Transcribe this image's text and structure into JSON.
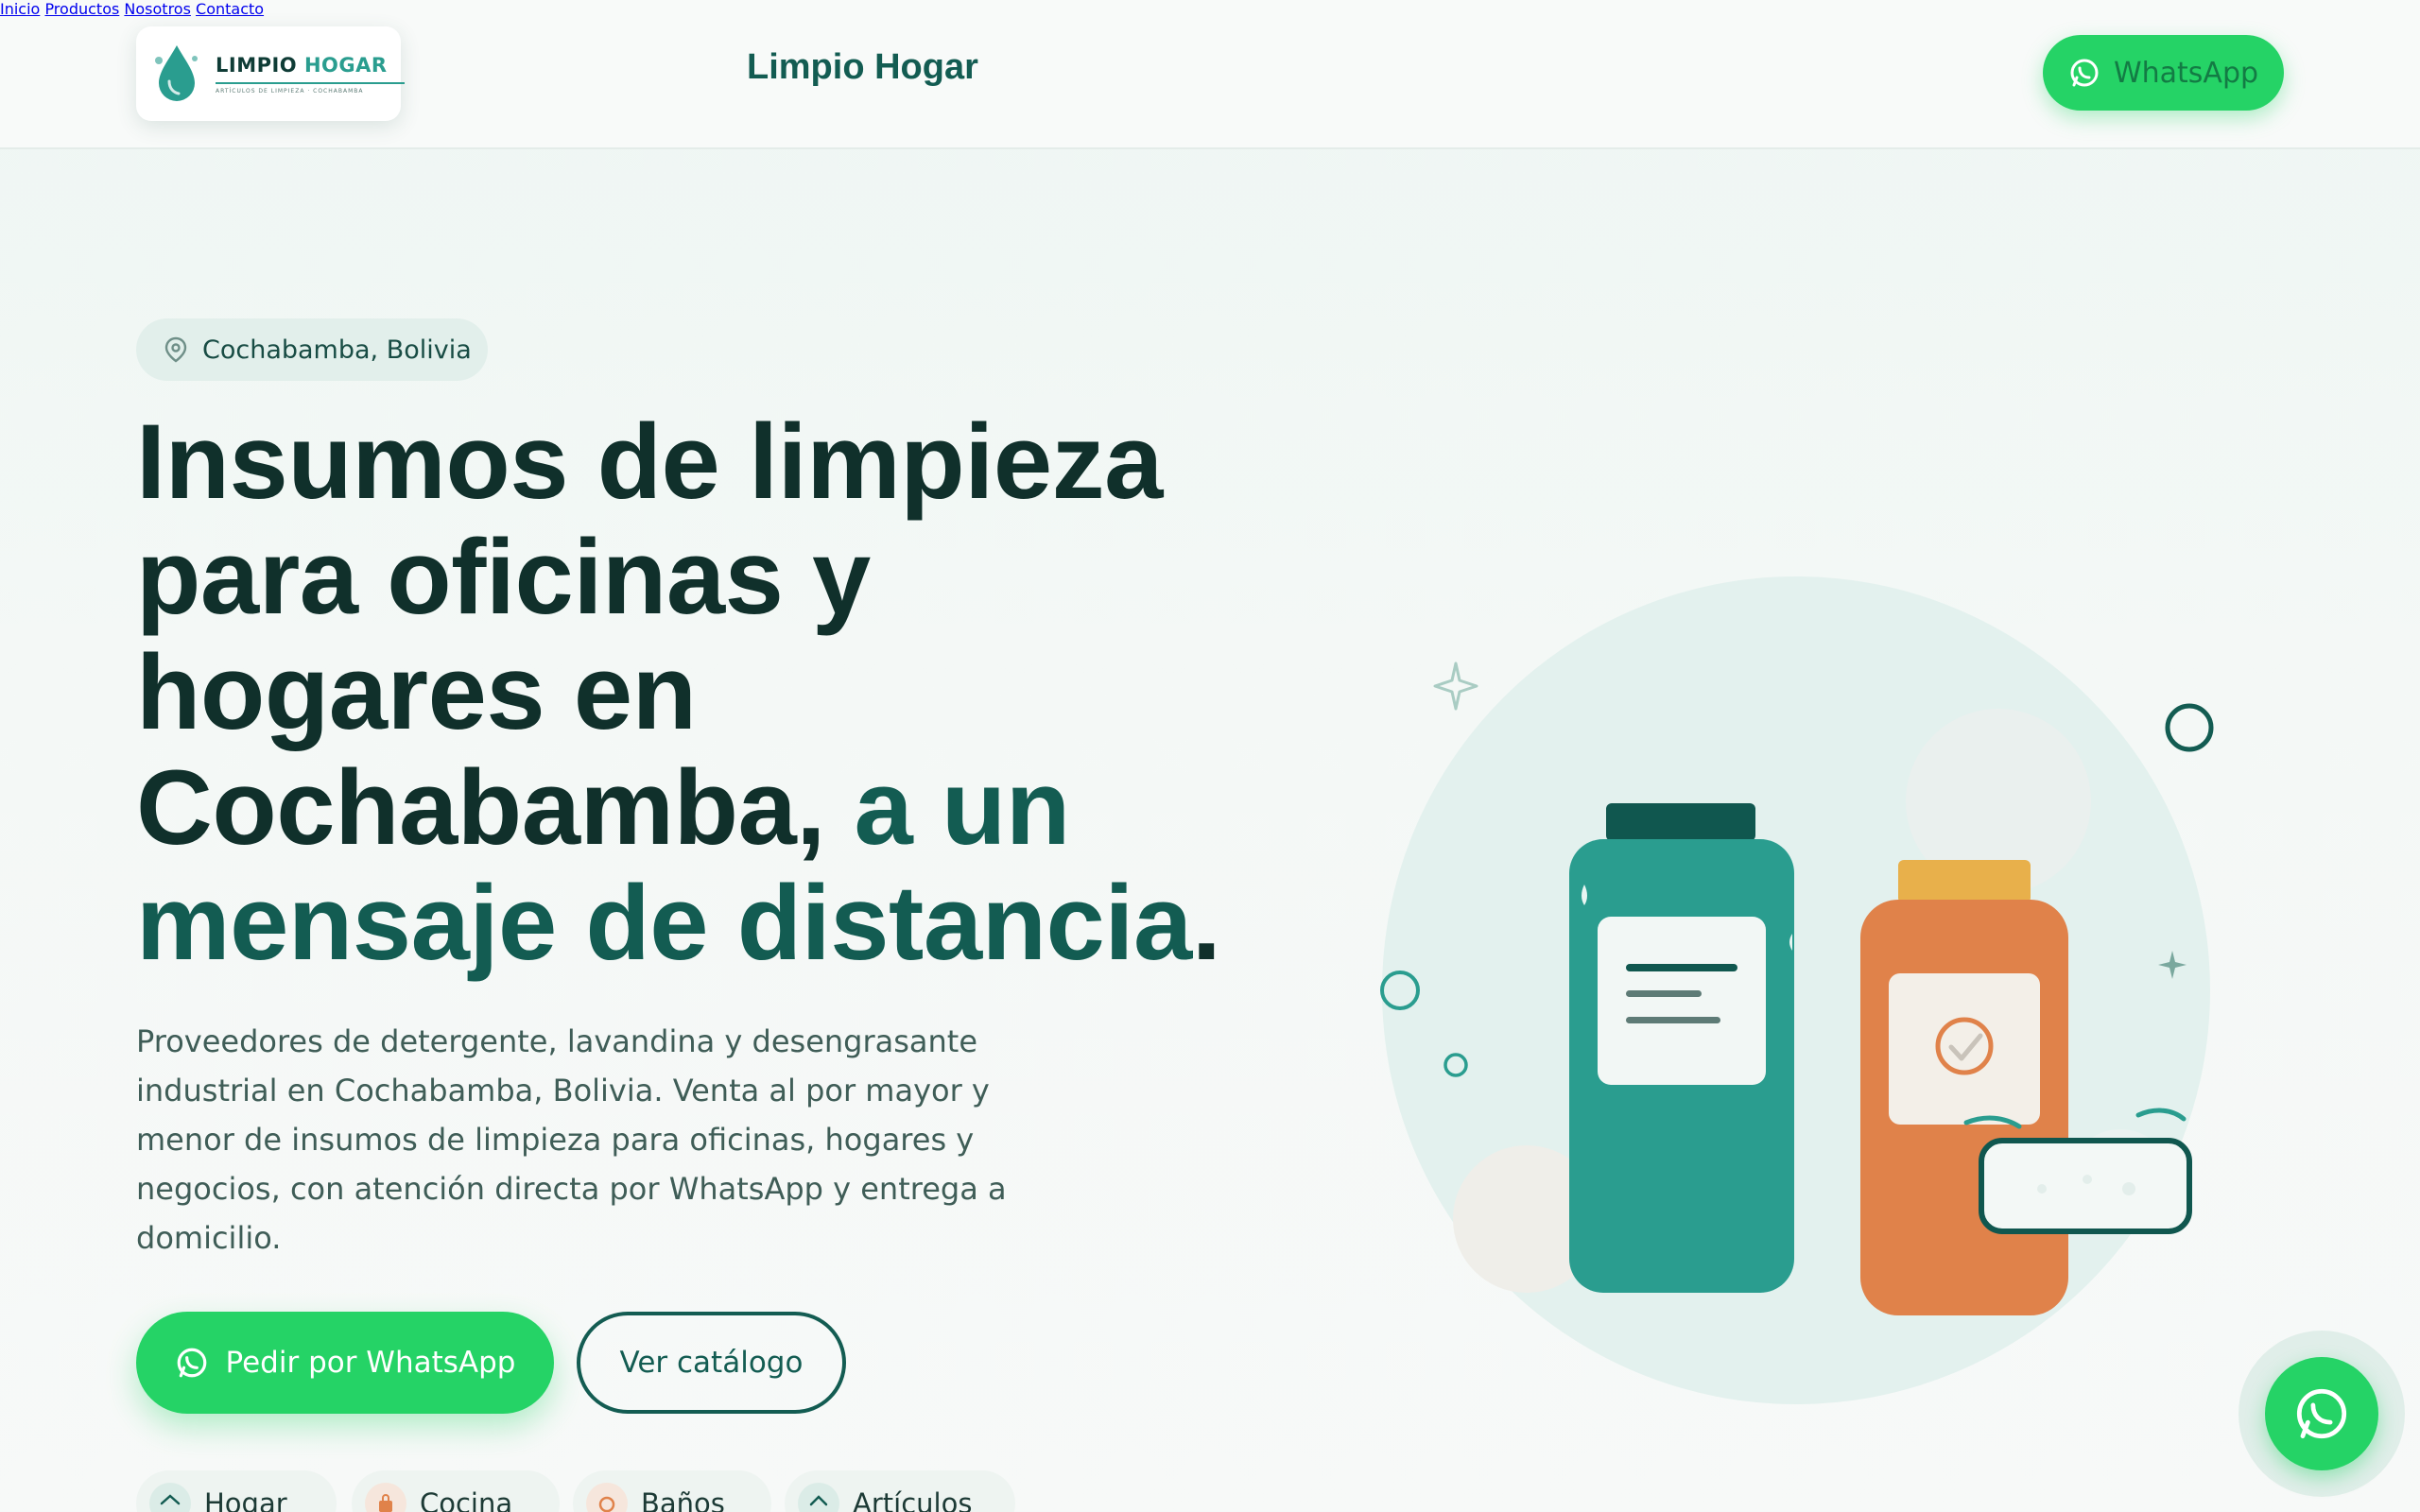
{
  "header": {
    "logo": {
      "name_part1": "LIMPIO",
      "name_part2": "HOGAR",
      "tagline": "ARTÍCULOS DE LIMPIEZA · COCHABAMBA"
    },
    "brand_title": "Limpio Hogar",
    "nav": [
      {
        "label": "Inicio"
      },
      {
        "label": "Productos"
      },
      {
        "label": "Nosotros"
      },
      {
        "label": "Contacto"
      }
    ],
    "whatsapp_button": "WhatsApp"
  },
  "hero": {
    "location_badge": "Cochabamba, Bolivia",
    "title_lines": [
      "Insumos de limpieza",
      "para oficinas y",
      "hogares en"
    ],
    "title_line4_dark": "Cochabamba, ",
    "title_line4_highlight": "a un",
    "title_line5_highlight": "mensaje de distancia",
    "title_line5_dark": ".",
    "description": "Proveedores de detergente, lavandina y desengrasante industrial en Cochabamba, Bolivia. Venta al por mayor y menor de insumos de limpieza para oficinas, hogares y negocios, con atención directa por WhatsApp y entrega a domicilio.",
    "cta_primary": "Pedir por WhatsApp",
    "cta_secondary": "Ver catálogo",
    "categories": [
      {
        "label": "Hogar",
        "icon": "home-icon"
      },
      {
        "label": "Cocina",
        "icon": "bag-icon"
      },
      {
        "label": "Baños",
        "icon": "bath-icon"
      },
      {
        "label": "Artículos",
        "icon": "tag-icon"
      }
    ]
  },
  "colors": {
    "primary": "#135c52",
    "teal": "#2a9d8f",
    "whatsapp": "#25d366",
    "orange": "#e0824a",
    "yellow": "#e8b04b",
    "text_dark": "#10302b"
  }
}
